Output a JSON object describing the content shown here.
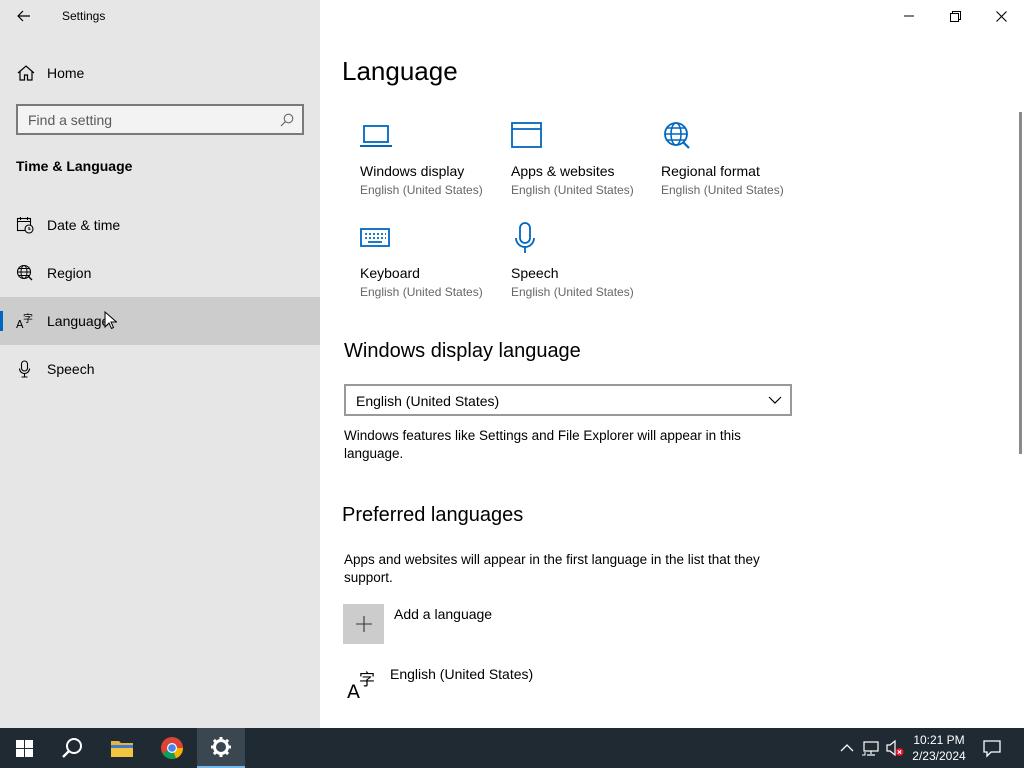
{
  "window": {
    "title": "Settings",
    "minimize_icon": "minimize-icon",
    "restore_icon": "restore-icon",
    "close_icon": "close-icon"
  },
  "sidebar": {
    "home_label": "Home",
    "search_placeholder": "Find a setting",
    "section_title": "Time & Language",
    "items": [
      {
        "label": "Date & time",
        "icon": "calendar-clock-icon"
      },
      {
        "label": "Region",
        "icon": "globe-icon"
      },
      {
        "label": "Language",
        "icon": "language-icon",
        "selected": true
      },
      {
        "label": "Speech",
        "icon": "microphone-icon"
      }
    ]
  },
  "main": {
    "title": "Language",
    "tiles": [
      {
        "name": "Windows display",
        "sub": "English (United States)",
        "icon": "laptop-icon"
      },
      {
        "name": "Apps & websites",
        "sub": "English (United States)",
        "icon": "browser-window-icon"
      },
      {
        "name": "Regional format",
        "sub": "English (United States)",
        "icon": "globe-icon"
      },
      {
        "name": "Keyboard",
        "sub": "English (United States)",
        "icon": "keyboard-icon"
      },
      {
        "name": "Speech",
        "sub": "English (United States)",
        "icon": "microphone-icon"
      }
    ],
    "display_language": {
      "heading": "Windows display language",
      "selected": "English (United States)",
      "description": "Windows features like Settings and File Explorer will appear in this language."
    },
    "preferred": {
      "heading": "Preferred languages",
      "description": "Apps and websites will appear in the first language in the list that they support.",
      "add_label": "Add a language",
      "languages": [
        "English (United States)"
      ]
    }
  },
  "taskbar": {
    "time": "10:21 PM",
    "date": "2/23/2024",
    "accent": "#76b9ed",
    "background": "#1f2a33"
  },
  "colors": {
    "accent_blue": "#0067c0",
    "sidebar_bg": "#e6e6e6",
    "selected_bg": "#cccccc"
  }
}
